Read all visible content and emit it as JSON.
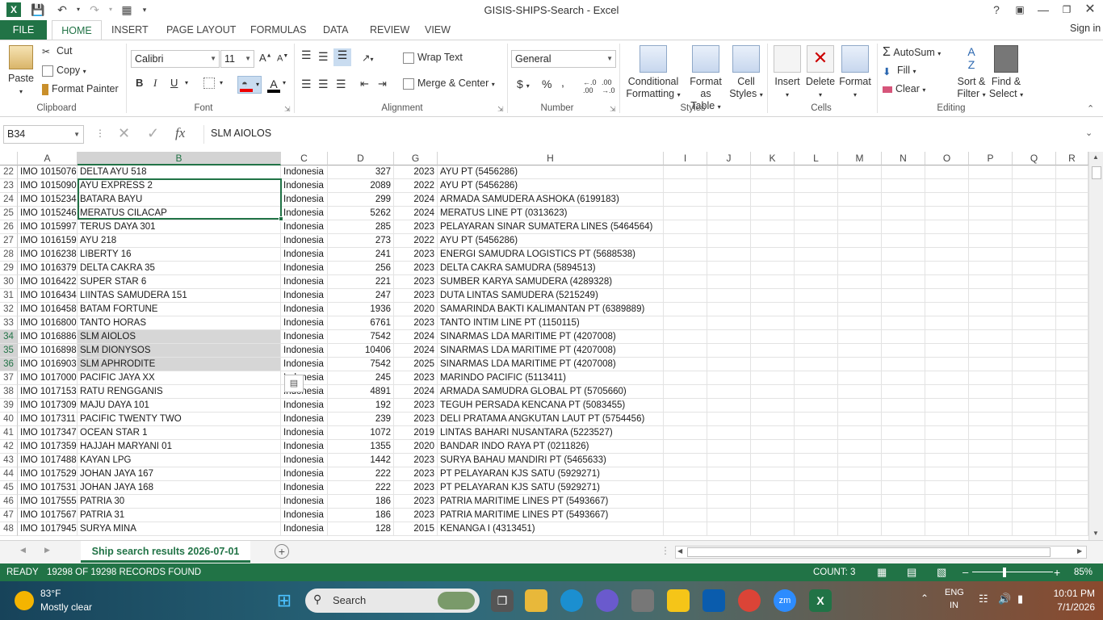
{
  "app": {
    "title": "GISIS-SHIPS-Search - Excel",
    "sign_in": "Sign in"
  },
  "tabs": [
    "FILE",
    "HOME",
    "INSERT",
    "PAGE LAYOUT",
    "FORMULAS",
    "DATA",
    "REVIEW",
    "VIEW"
  ],
  "clipboard": {
    "paste": "Paste",
    "cut": "Cut",
    "copy": "Copy",
    "format_painter": "Format Painter",
    "label": "Clipboard"
  },
  "font": {
    "name": "Calibri",
    "size": "11",
    "label": "Font",
    "bold": "B",
    "italic": "I",
    "underline": "U"
  },
  "alignment": {
    "wrap_text": "Wrap Text",
    "merge_center": "Merge & Center",
    "label": "Alignment"
  },
  "number": {
    "format": "General",
    "currency": "$",
    "percent": "%",
    "comma": ",",
    "label": "Number"
  },
  "styles": {
    "conditional": "Conditional",
    "formatting": "Formatting",
    "format_as": "Format as",
    "table": "Table",
    "cell": "Cell",
    "cell_styles": "Styles",
    "label": "Styles"
  },
  "cells": {
    "insert": "Insert",
    "delete": "Delete",
    "format": "Format",
    "label": "Cells"
  },
  "editing": {
    "autosum": "AutoSum",
    "fill": "Fill",
    "clear": "Clear",
    "sort": "Sort &",
    "filter": "Filter",
    "find": "Find &",
    "select": "Select",
    "label": "Editing"
  },
  "formula_bar": {
    "name_box": "B34",
    "fx": "fx",
    "value": "SLM AIOLOS"
  },
  "columns": [
    "A",
    "B",
    "C",
    "D",
    "G",
    "H",
    "I",
    "J",
    "K",
    "L",
    "M",
    "N",
    "O",
    "P",
    "Q",
    "R"
  ],
  "rows": [
    {
      "n": "22",
      "a": "IMO 1015076",
      "b": "DELTA AYU 518",
      "c": "Indonesia",
      "d": "327",
      "g": "2023",
      "h": "AYU PT (5456286)"
    },
    {
      "n": "23",
      "a": "IMO 1015090",
      "b": "AYU EXPRESS 2",
      "c": "Indonesia",
      "d": "2089",
      "g": "2022",
      "h": "AYU PT (5456286)"
    },
    {
      "n": "24",
      "a": "IMO 1015234",
      "b": "BATARA BAYU",
      "c": "Indonesia",
      "d": "299",
      "g": "2024",
      "h": "ARMADA SAMUDERA ASHOKA (6199183)"
    },
    {
      "n": "25",
      "a": "IMO 1015246",
      "b": "MERATUS CILACAP",
      "c": "Indonesia",
      "d": "5262",
      "g": "2024",
      "h": "MERATUS LINE PT (0313623)"
    },
    {
      "n": "26",
      "a": "IMO 1015997",
      "b": "TERUS DAYA 301",
      "c": "Indonesia",
      "d": "285",
      "g": "2023",
      "h": "PELAYARAN SINAR SUMATERA LINES (5464564)"
    },
    {
      "n": "27",
      "a": "IMO 1016159",
      "b": "AYU 218",
      "c": "Indonesia",
      "d": "273",
      "g": "2022",
      "h": "AYU PT (5456286)"
    },
    {
      "n": "28",
      "a": "IMO 1016238",
      "b": "LIBERTY 16",
      "c": "Indonesia",
      "d": "241",
      "g": "2023",
      "h": "ENERGI SAMUDRA LOGISTICS PT (5688538)"
    },
    {
      "n": "29",
      "a": "IMO 1016379",
      "b": "DELTA CAKRA 35",
      "c": "Indonesia",
      "d": "256",
      "g": "2023",
      "h": "DELTA CAKRA SAMUDRA (5894513)"
    },
    {
      "n": "30",
      "a": "IMO 1016422",
      "b": "SUPER STAR 6",
      "c": "Indonesia",
      "d": "221",
      "g": "2023",
      "h": "SUMBER KARYA SAMUDERA (4289328)"
    },
    {
      "n": "31",
      "a": "IMO 1016434",
      "b": "LIINTAS SAMUDERA 151",
      "c": "Indonesia",
      "d": "247",
      "g": "2023",
      "h": "DUTA LINTAS SAMUDERA (5215249)"
    },
    {
      "n": "32",
      "a": "IMO 1016458",
      "b": "BATAM FORTUNE",
      "c": "Indonesia",
      "d": "1936",
      "g": "2020",
      "h": "SAMARINDA BAKTI KALIMANTAN PT (6389889)"
    },
    {
      "n": "33",
      "a": "IMO 1016800",
      "b": "TANTO HORAS",
      "c": "Indonesia",
      "d": "6761",
      "g": "2023",
      "h": "TANTO INTIM LINE PT (1150115)"
    },
    {
      "n": "34",
      "a": "IMO 1016886",
      "b": "SLM AIOLOS",
      "c": "Indonesia",
      "d": "7542",
      "g": "2024",
      "h": "SINARMAS LDA MARITIME PT (4207008)",
      "sel": true
    },
    {
      "n": "35",
      "a": "IMO 1016898",
      "b": "SLM DIONYSOS",
      "c": "Indonesia",
      "d": "10406",
      "g": "2024",
      "h": "SINARMAS LDA MARITIME PT (4207008)",
      "sel": true
    },
    {
      "n": "36",
      "a": "IMO 1016903",
      "b": "SLM APHRODITE",
      "c": "Indonesia",
      "d": "7542",
      "g": "2025",
      "h": "SINARMAS LDA MARITIME PT (4207008)",
      "sel": true
    },
    {
      "n": "37",
      "a": "IMO 1017000",
      "b": "PACIFIC JAYA XX",
      "c": "Indonesia",
      "d": "245",
      "g": "2023",
      "h": "MARINDO PACIFIC (5113411)"
    },
    {
      "n": "38",
      "a": "IMO 1017153",
      "b": "RATU RENGGANIS",
      "c": "Indonesia",
      "d": "4891",
      "g": "2024",
      "h": "ARMADA SAMUDRA GLOBAL PT (5705660)"
    },
    {
      "n": "39",
      "a": "IMO 1017309",
      "b": "MAJU DAYA 101",
      "c": "Indonesia",
      "d": "192",
      "g": "2023",
      "h": "TEGUH PERSADA KENCANA PT (5083455)"
    },
    {
      "n": "40",
      "a": "IMO 1017311",
      "b": "PACIFIC TWENTY TWO",
      "c": "Indonesia",
      "d": "239",
      "g": "2023",
      "h": "DELI PRATAMA ANGKUTAN LAUT PT (5754456)"
    },
    {
      "n": "41",
      "a": "IMO 1017347",
      "b": "OCEAN STAR 1",
      "c": "Indonesia",
      "d": "1072",
      "g": "2019",
      "h": "LINTAS BAHARI NUSANTARA (5223527)"
    },
    {
      "n": "42",
      "a": "IMO 1017359",
      "b": "HAJJAH MARYANI 01",
      "c": "Indonesia",
      "d": "1355",
      "g": "2020",
      "h": "BANDAR INDO RAYA PT (0211826)"
    },
    {
      "n": "43",
      "a": "IMO 1017488",
      "b": "KAYAN LPG",
      "c": "Indonesia",
      "d": "1442",
      "g": "2023",
      "h": "SURYA BAHAU MANDIRI PT (5465633)"
    },
    {
      "n": "44",
      "a": "IMO 1017529",
      "b": "JOHAN JAYA 167",
      "c": "Indonesia",
      "d": "222",
      "g": "2023",
      "h": "PT PELAYARAN KJS SATU (5929271)"
    },
    {
      "n": "45",
      "a": "IMO 1017531",
      "b": "JOHAN JAYA 168",
      "c": "Indonesia",
      "d": "222",
      "g": "2023",
      "h": "PT PELAYARAN KJS SATU (5929271)"
    },
    {
      "n": "46",
      "a": "IMO 1017555",
      "b": "PATRIA 30",
      "c": "Indonesia",
      "d": "186",
      "g": "2023",
      "h": "PATRIA MARITIME LINES PT (5493667)"
    },
    {
      "n": "47",
      "a": "IMO 1017567",
      "b": "PATRIA 31",
      "c": "Indonesia",
      "d": "186",
      "g": "2023",
      "h": "PATRIA MARITIME LINES PT (5493667)"
    },
    {
      "n": "48",
      "a": "IMO 1017945",
      "b": "SURYA MINA",
      "c": "Indonesia",
      "d": "128",
      "g": "2015",
      "h": "KENANGA I (4313451)"
    }
  ],
  "sheet": {
    "tab": "Ship search results 2026-07-01"
  },
  "status": {
    "ready": "READY",
    "records": "19298 OF 19298 RECORDS FOUND",
    "count": "COUNT: 3",
    "zoom": "85%"
  },
  "taskbar": {
    "temp": "83°F",
    "weather": "Mostly clear",
    "search": "Search",
    "lang1": "ENG",
    "lang2": "IN",
    "time": "10:01 PM",
    "date": "7/1/2026"
  },
  "colors": {
    "accent": "#217346"
  }
}
